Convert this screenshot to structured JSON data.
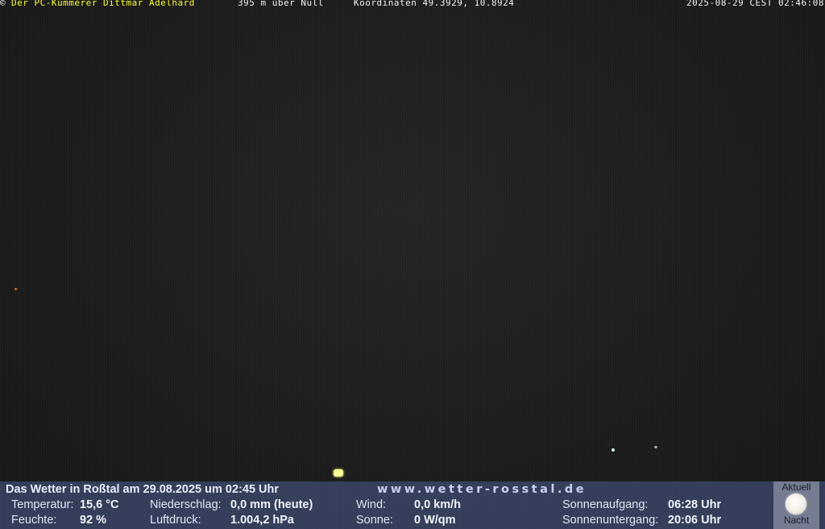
{
  "overlay": {
    "copyright_symbol": "©",
    "owner": "Der PC-Kümmerer Dittmar Adelhard",
    "altitude": "395 m über Null",
    "coordinates": "Koordinaten 49.3929, 10.8924",
    "datetime": "2025-08-29 CEST 02:46:08",
    "owner_color": "#ffff33"
  },
  "weather": {
    "title": "Das Wetter in Roßtal am 29.08.2025 um 02:45 Uhr",
    "website": "www.wetter-rosstal.de",
    "temperature_label": "Temperatur:",
    "temperature_value": "15,6 °C",
    "humidity_label": "Feuchte:",
    "humidity_value": "92 %",
    "precip_label": "Niederschlag:",
    "precip_value": "0,0 mm (heute)",
    "pressure_label": "Luftdruck:",
    "pressure_value": "1.004,2 hPa",
    "wind_label": "Wind:",
    "wind_value": "0,0 km/h",
    "sun_label": "Sonne:",
    "sun_value": "0 W/qm",
    "sunrise_label": "Sonnenaufgang:",
    "sunrise_value": "06:28 Uhr",
    "sunset_label": "Sonnenuntergang:",
    "sunset_value": "20:06 Uhr"
  },
  "moon": {
    "top_label": "Aktuell",
    "bottom_label": "Nacht",
    "icon": "moon-icon"
  }
}
